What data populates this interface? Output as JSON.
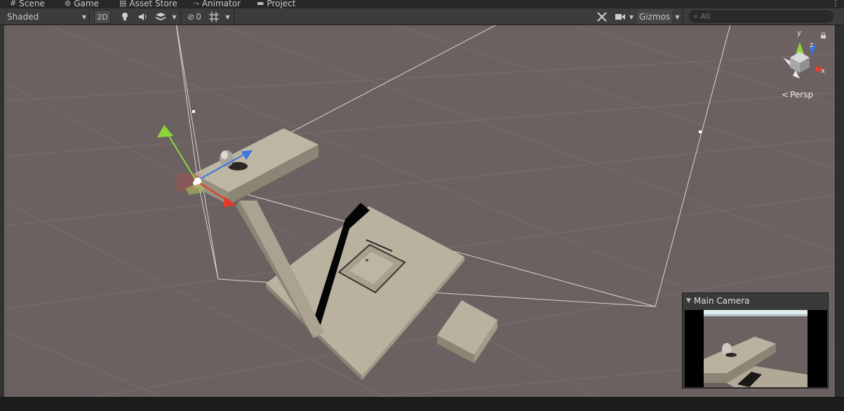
{
  "tabs": [
    {
      "label": "Scene",
      "icon": "grid-icon"
    },
    {
      "label": "Game",
      "icon": "gamepad-icon"
    },
    {
      "label": "Asset Store",
      "icon": "store-icon"
    },
    {
      "label": "Animator",
      "icon": "animator-icon"
    },
    {
      "label": "Project",
      "icon": "folder-icon"
    }
  ],
  "toolbar": {
    "shading_mode": "Shaded",
    "btn_2d": "2D",
    "hidden_count": "0",
    "gizmos_label": "Gizmos",
    "search_placeholder": "All"
  },
  "gizmo": {
    "y_label": "y",
    "z_label": "z",
    "x_label": "x",
    "projection_label": "Persp",
    "colors": {
      "x": "#e53a2e",
      "y": "#8cd43a",
      "z": "#3a74e5"
    }
  },
  "camera_preview": {
    "title": "Main Camera"
  },
  "scene_colors": {
    "background": "#6a6160",
    "grid": "#7b7371",
    "platform": "#b9b29f",
    "platform_side": "#8a8574",
    "shadow": "#050505"
  }
}
